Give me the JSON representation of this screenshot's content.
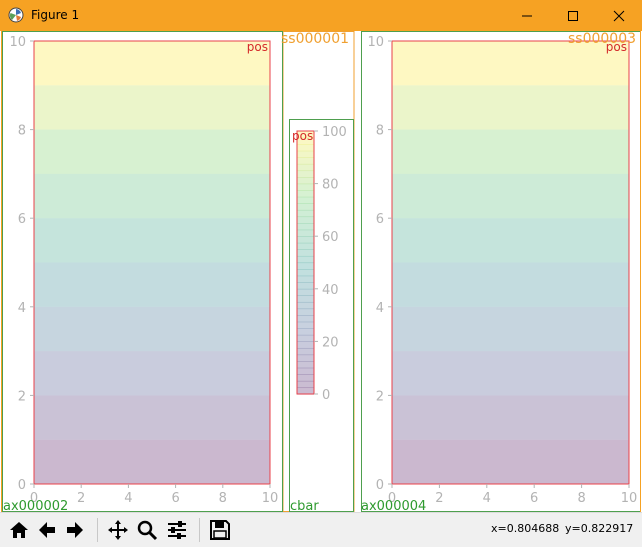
{
  "window": {
    "title": "Figure 1",
    "accent": "#f6a223"
  },
  "toolbar": {
    "buttons": [
      "home-icon",
      "back-arrow-icon",
      "forward-arrow-icon",
      "pan-icon",
      "zoom-icon",
      "configure-subplots-icon",
      "save-icon"
    ],
    "x_readout": "x=0.804688",
    "y_readout": "y=0.822917"
  },
  "labels": {
    "left_frame": "ax000002",
    "right_frame": "ax000004",
    "cbar_frame": "cbar",
    "spine_1": "ss000001",
    "spine_3": "ss000003",
    "pos": "pos"
  },
  "chart_data": [
    {
      "type": "heatmap",
      "name": "ax000002",
      "x": [
        0,
        2,
        4,
        6,
        8,
        10
      ],
      "y_ticks": [
        0,
        2,
        4,
        6,
        8,
        10
      ],
      "xlim": [
        0,
        10
      ],
      "ylim": [
        0,
        10
      ],
      "rows": [
        0,
        10,
        20,
        30,
        40,
        50,
        60,
        70,
        80,
        90
      ]
    },
    {
      "type": "heatmap",
      "name": "ax000004",
      "x": [
        0,
        2,
        4,
        6,
        8,
        10
      ],
      "y_ticks": [
        0,
        2,
        4,
        6,
        8,
        10
      ],
      "xlim": [
        0,
        10
      ],
      "ylim": [
        0,
        10
      ],
      "rows": [
        0,
        10,
        20,
        30,
        40,
        50,
        60,
        70,
        80,
        90
      ]
    },
    {
      "type": "colorbar",
      "name": "cbar",
      "ticks": [
        0,
        20,
        40,
        60,
        80,
        100
      ],
      "ylim": [
        0,
        100
      ]
    }
  ]
}
